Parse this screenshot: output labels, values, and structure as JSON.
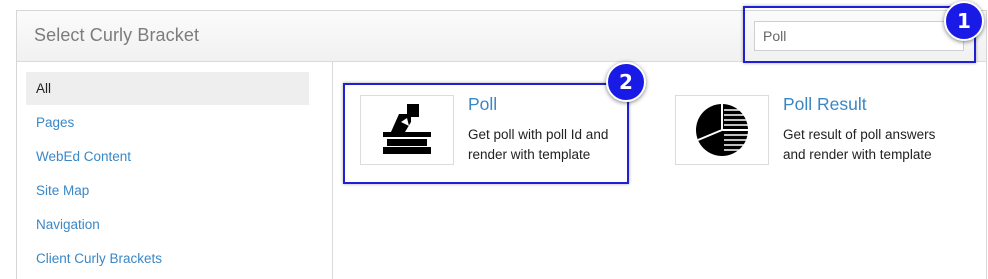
{
  "header": {
    "title": "Select Curly Bracket",
    "search": {
      "value": "Poll",
      "placeholder": ""
    }
  },
  "sidebar": {
    "items": [
      {
        "label": "All",
        "active": true
      },
      {
        "label": "Pages"
      },
      {
        "label": "WebEd Content"
      },
      {
        "label": "Site Map"
      },
      {
        "label": "Navigation"
      },
      {
        "label": "Client Curly Brackets"
      }
    ]
  },
  "cards": [
    {
      "title": "Poll",
      "description": "Get poll with poll Id and render with template",
      "icon": "ballot-box-icon"
    },
    {
      "title": "Poll Result",
      "description": "Get result of poll answers and render with template",
      "icon": "pie-chart-icon"
    }
  ],
  "callouts": [
    {
      "number": "1"
    },
    {
      "number": "2"
    }
  ],
  "colors": {
    "link": "#3a87c6",
    "callout": "#1a1ae6",
    "active_bg": "#eeeeee"
  }
}
